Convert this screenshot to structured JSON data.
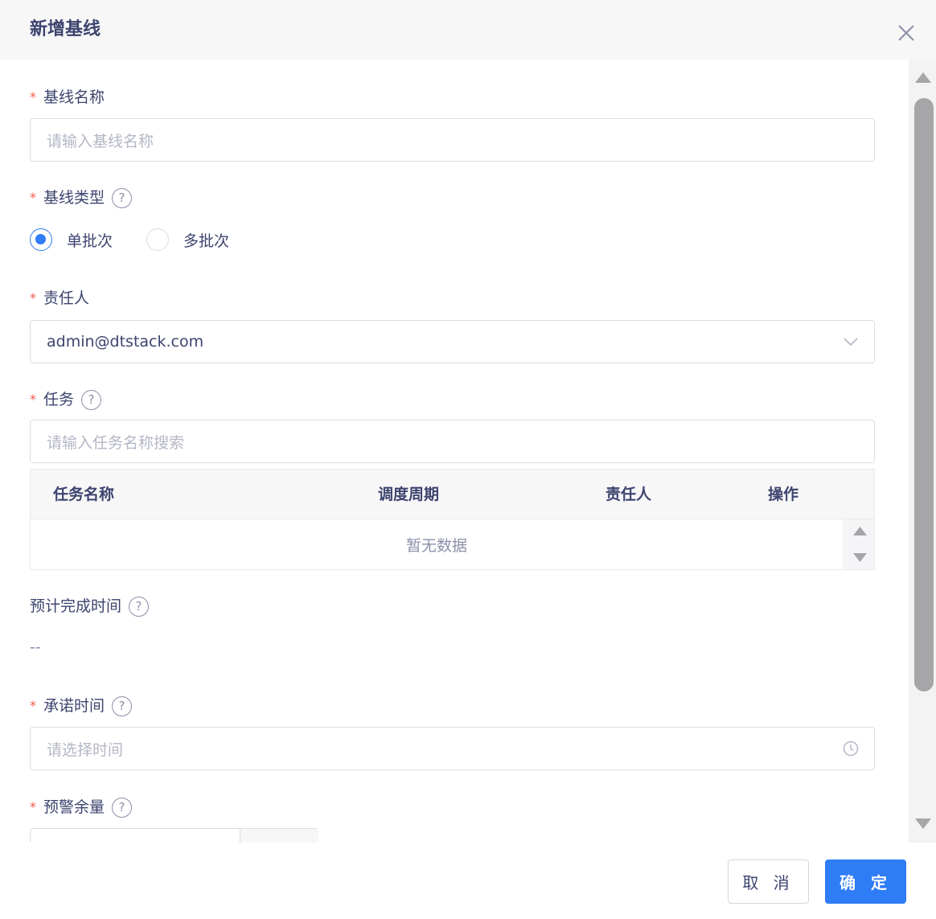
{
  "dialog": {
    "title": "新增基线"
  },
  "form": {
    "name": {
      "label": "基线名称",
      "placeholder": "请输入基线名称"
    },
    "type": {
      "label": "基线类型",
      "options": [
        {
          "label": "单批次",
          "checked": true
        },
        {
          "label": "多批次",
          "checked": false
        }
      ]
    },
    "owner": {
      "label": "责任人",
      "value": "admin@dtstack.com"
    },
    "task": {
      "label": "任务",
      "placeholder": "请输入任务名称搜索",
      "table": {
        "columns": [
          "任务名称",
          "调度周期",
          "责任人",
          "操作"
        ],
        "empty_text": "暂无数据"
      }
    },
    "estimated": {
      "label": "预计完成时间",
      "value": "--"
    },
    "promise": {
      "label": "承诺时间",
      "placeholder": "请选择时间"
    },
    "warning": {
      "label": "预警余量"
    }
  },
  "footer": {
    "cancel_label": "取 消",
    "ok_label": "确 定"
  },
  "colors": {
    "primary": "#2e7cf6",
    "required": "#f25a4c",
    "text": "#3d446e"
  },
  "icons": {
    "close": "close-icon",
    "help": "question-circle-icon",
    "dropdown": "chevron-down-icon",
    "clock": "clock-icon"
  }
}
